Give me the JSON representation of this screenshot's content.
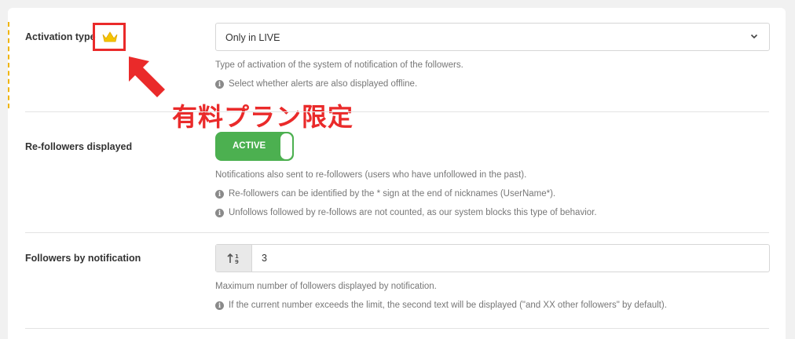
{
  "activation": {
    "label": "Activation type",
    "select_value": "Only in LIVE",
    "help": "Type of activation of the system of notification of the followers.",
    "note": "Select whether alerts are also displayed offline."
  },
  "annotation": {
    "text": "有料プラン限定",
    "color": "#ea2a2a",
    "crown_icon": "crown-icon"
  },
  "refollowers": {
    "label": "Re-followers displayed",
    "toggle_label": "ACTIVE",
    "toggle_color": "#4cb050",
    "help": "Notifications also sent to re-followers (users who have unfollowed in the past).",
    "notes": [
      "Re-followers can be identified by the * sign at the end of nicknames (UserName*).",
      "Unfollows followed by re-follows are not counted, as our system blocks this type of behavior."
    ]
  },
  "followers_by_notification": {
    "label": "Followers by notification",
    "value": "3",
    "prefix_icon": "sort-number-icon",
    "help": "Maximum number of followers displayed by notification.",
    "note": "If the current number exceeds the limit, the second text will be displayed (\"and XX other followers\" by default)."
  }
}
